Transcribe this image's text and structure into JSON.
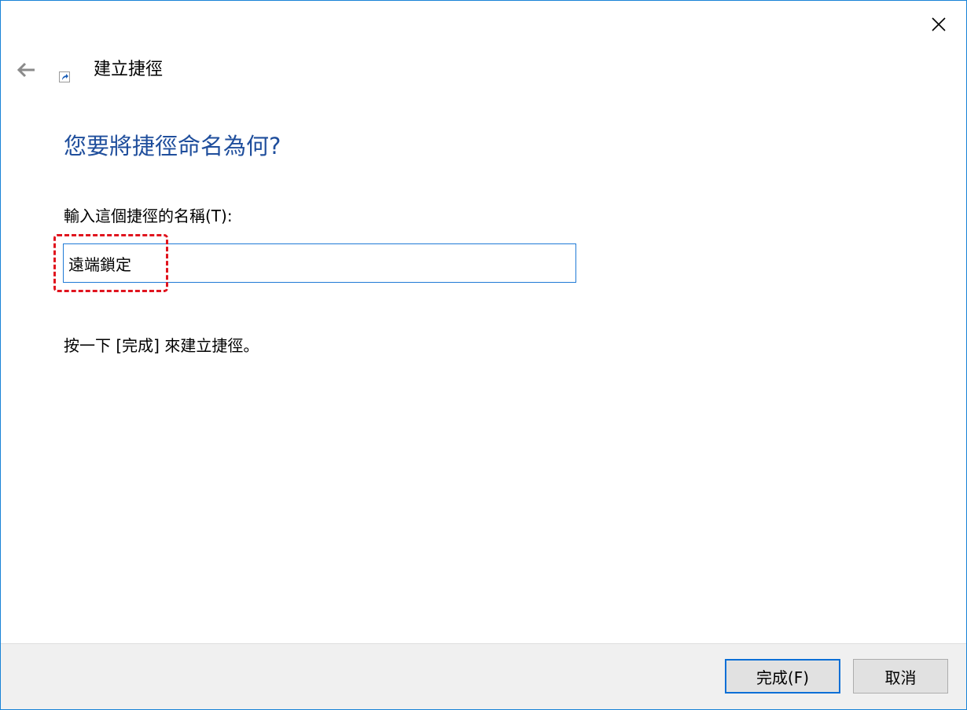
{
  "window": {
    "title": "建立捷徑"
  },
  "icons": {
    "close": "close-icon",
    "back": "back-arrow-icon",
    "shortcut": "shortcut-icon"
  },
  "main": {
    "heading": "您要將捷徑命名為何?",
    "field_label": "輸入這個捷徑的名稱(T):",
    "name_value": "遠端鎖定",
    "hint": "按一下 [完成] 來建立捷徑。"
  },
  "footer": {
    "finish_label": "完成(F)",
    "cancel_label": "取消"
  },
  "colors": {
    "heading": "#1f4e9c",
    "accent_border": "#1883d7",
    "highlight": "#e0141e",
    "footer_bg": "#f0f0f0"
  }
}
